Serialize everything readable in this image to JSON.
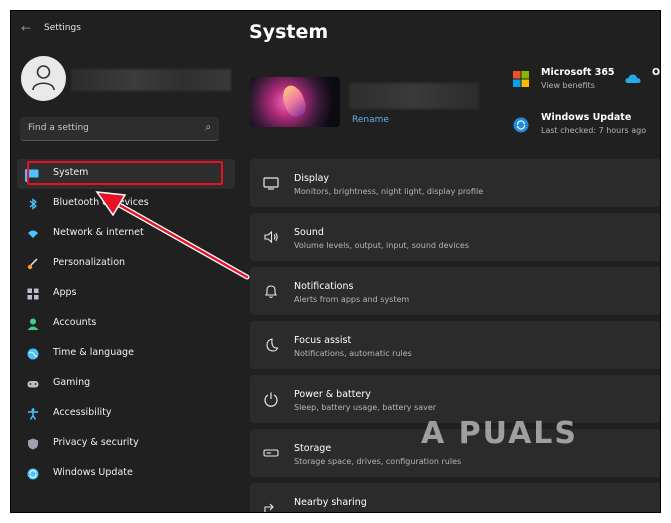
{
  "window": {
    "title": "Settings",
    "back_glyph": "←"
  },
  "sidebar": {
    "search_placeholder": "Find a setting",
    "items": [
      {
        "label": "System",
        "icon": "system-icon",
        "color": "#4cc2ff"
      },
      {
        "label": "Bluetooth & devices",
        "icon": "bluetooth-icon",
        "color": "#4cc2ff"
      },
      {
        "label": "Network & internet",
        "icon": "wifi-icon",
        "color": "#4cc2ff"
      },
      {
        "label": "Personalization",
        "icon": "brush-icon",
        "color": "#f0a030"
      },
      {
        "label": "Apps",
        "icon": "apps-icon",
        "color": "#9ca3af"
      },
      {
        "label": "Accounts",
        "icon": "accounts-icon",
        "color": "#3ecf8e"
      },
      {
        "label": "Time & language",
        "icon": "globe-icon",
        "color": "#4cc2ff"
      },
      {
        "label": "Gaming",
        "icon": "gamepad-icon",
        "color": "#9ca3af"
      },
      {
        "label": "Accessibility",
        "icon": "accessibility-icon",
        "color": "#4cc2ff"
      },
      {
        "label": "Privacy & security",
        "icon": "shield-icon",
        "color": "#9ca3af"
      },
      {
        "label": "Windows Update",
        "icon": "update-icon",
        "color": "#4cc2ff"
      }
    ]
  },
  "main": {
    "title": "System",
    "rename_label": "Rename",
    "m365": {
      "title": "Microsoft 365",
      "subtitle": "View benefits"
    },
    "onedrive": {
      "title": "O"
    },
    "windows_update": {
      "title": "Windows Update",
      "subtitle": "Last checked: 7 hours ago"
    },
    "cards": [
      {
        "title": "Display",
        "subtitle": "Monitors, brightness, night light, display profile",
        "icon": "display-icon"
      },
      {
        "title": "Sound",
        "subtitle": "Volume levels, output, input, sound devices",
        "icon": "sound-icon"
      },
      {
        "title": "Notifications",
        "subtitle": "Alerts from apps and system",
        "icon": "bell-icon"
      },
      {
        "title": "Focus assist",
        "subtitle": "Notifications, automatic rules",
        "icon": "moon-icon"
      },
      {
        "title": "Power & battery",
        "subtitle": "Sleep, battery usage, battery saver",
        "icon": "power-icon"
      },
      {
        "title": "Storage",
        "subtitle": "Storage space, drives, configuration rules",
        "icon": "storage-icon"
      },
      {
        "title": "Nearby sharing",
        "subtitle": "",
        "icon": "share-icon"
      }
    ]
  },
  "watermark": "A  PUALS",
  "colors": {
    "accent": "#4cc2ff",
    "annotation": "#e81123",
    "background": "#202020",
    "card": "#2b2b2b"
  }
}
